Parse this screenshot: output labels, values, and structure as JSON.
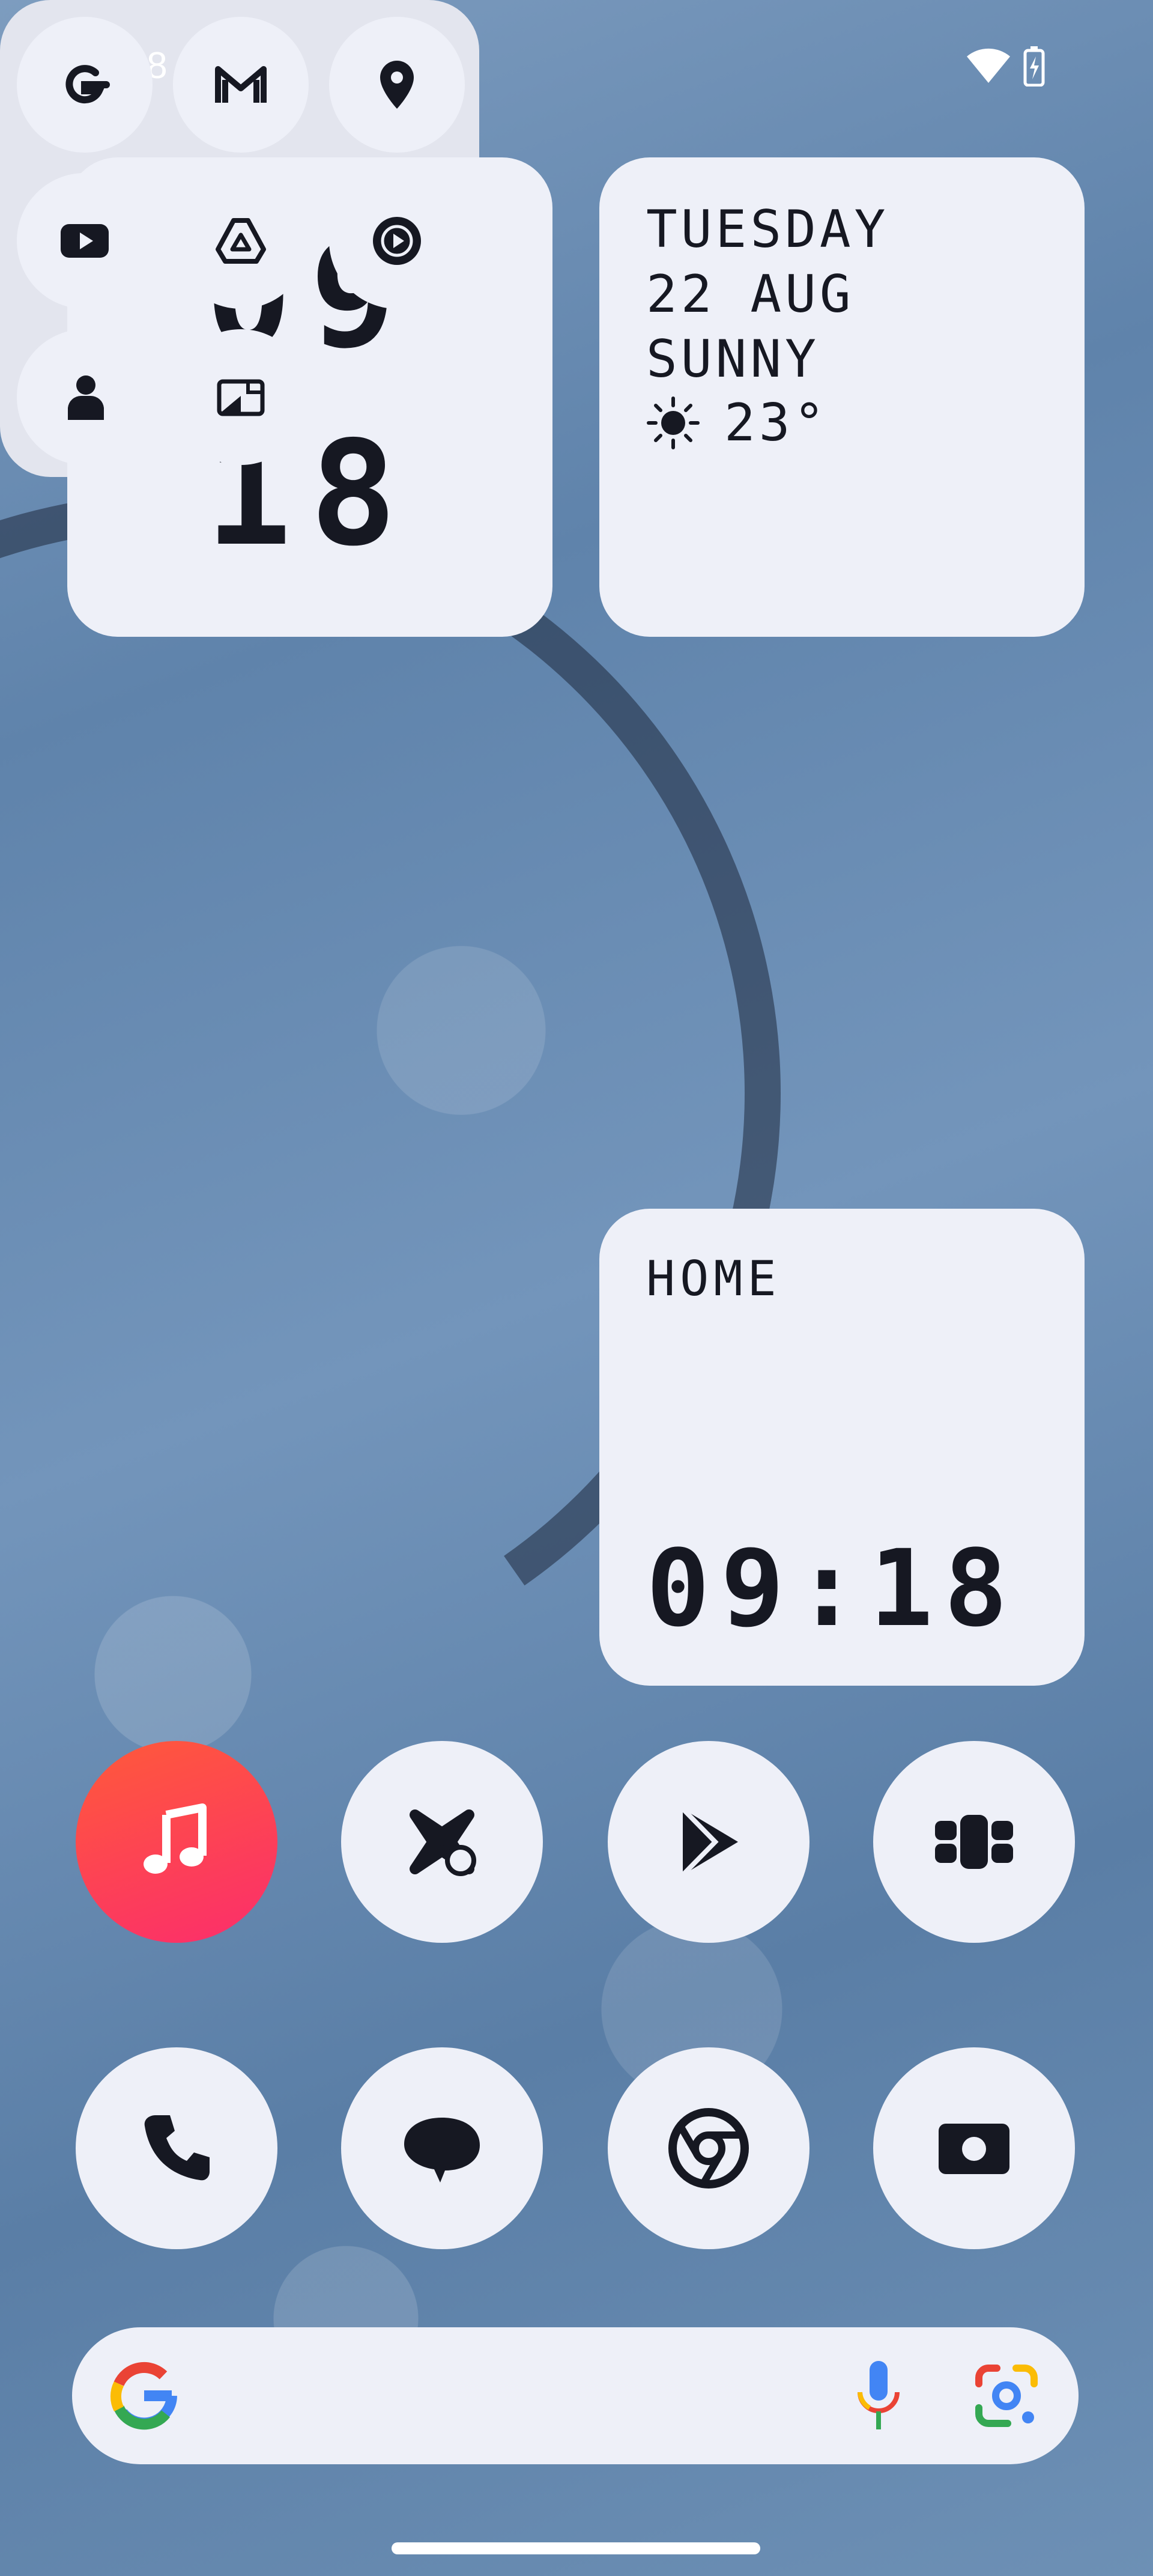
{
  "status_bar": {
    "time": "9:18",
    "icons": [
      "cloud-icon",
      "wifi-icon",
      "battery-charging-icon"
    ]
  },
  "clock_widget": {
    "hour": "09",
    "minute": "18"
  },
  "date_widget": {
    "day": "TUESDAY",
    "date": "22 AUG",
    "condition": "SUNNY",
    "temperature": "23°",
    "weather_icon": "sun-icon"
  },
  "apps_folder": {
    "items": [
      {
        "name": "Google",
        "icon": "google-g-icon"
      },
      {
        "name": "Gmail",
        "icon": "gmail-icon"
      },
      {
        "name": "Maps",
        "icon": "map-pin-icon"
      },
      {
        "name": "YouTube",
        "icon": "youtube-icon"
      },
      {
        "name": "Drive",
        "icon": "drive-icon"
      },
      {
        "name": "YouTube Music",
        "icon": "play-circle-icon"
      },
      {
        "name": "Contacts",
        "icon": "person-icon"
      },
      {
        "name": "Photos",
        "icon": "photos-icon"
      }
    ]
  },
  "home_widget": {
    "label": "HOME",
    "time": "09:18"
  },
  "app_row": [
    {
      "name": "Music",
      "icon": "music-note-icon"
    },
    {
      "name": "Nothing X",
      "icon": "nothing-x-icon"
    },
    {
      "name": "Play Store",
      "icon": "play-store-icon"
    },
    {
      "name": "App Drawer",
      "icon": "grid-dots-icon"
    }
  ],
  "dock": [
    {
      "name": "Phone",
      "icon": "phone-icon"
    },
    {
      "name": "Messages",
      "icon": "chat-bubble-icon"
    },
    {
      "name": "Chrome",
      "icon": "chrome-icon"
    },
    {
      "name": "Camera",
      "icon": "camera-icon"
    }
  ],
  "search_bar": {
    "icons": [
      "google-logo-icon",
      "microphone-icon",
      "google-lens-icon"
    ]
  },
  "colors": {
    "widget_bg": "#eef0f8",
    "text_dark": "#161822",
    "music_gradient_start": "#ff5a3a",
    "music_gradient_end": "#fb2d6c"
  }
}
